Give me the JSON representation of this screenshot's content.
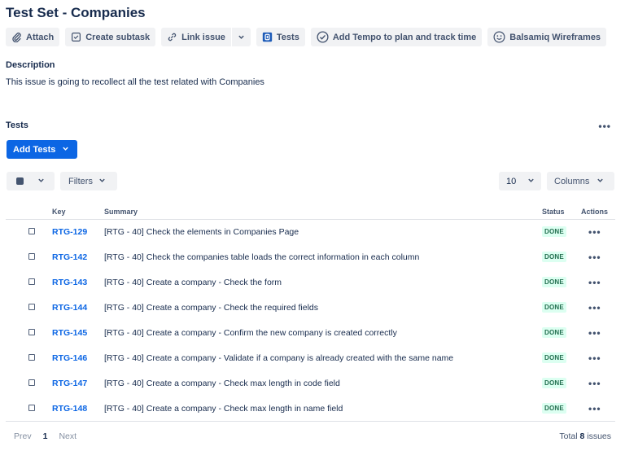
{
  "issue": {
    "title": "Test Set - Companies"
  },
  "toolbar": {
    "attach": "Attach",
    "create_subtask": "Create subtask",
    "link_issue": "Link issue",
    "tests": "Tests",
    "tempo": "Add Tempo to plan and track time",
    "balsamiq": "Balsamiq Wireframes"
  },
  "description": {
    "heading": "Description",
    "text": "This issue is going to recollect all the test related with Companies"
  },
  "tests": {
    "heading": "Tests",
    "more": "•••",
    "add_button": "Add Tests",
    "filters_label": "Filters",
    "page_size": "10",
    "columns_label": "Columns",
    "columns": {
      "key": "Key",
      "summary": "Summary",
      "status": "Status",
      "actions": "Actions"
    },
    "rows": [
      {
        "key": "RTG-129",
        "summary": "[RTG - 40] Check the elements in Companies Page",
        "status": "DONE",
        "actions": "•••"
      },
      {
        "key": "RTG-142",
        "summary": "[RTG - 40] Check the companies table loads the correct information in each column",
        "status": "DONE",
        "actions": "•••"
      },
      {
        "key": "RTG-143",
        "summary": "[RTG - 40] Create a company - Check the form",
        "status": "DONE",
        "actions": "•••"
      },
      {
        "key": "RTG-144",
        "summary": "[RTG - 40] Create a company - Check the required fields",
        "status": "DONE",
        "actions": "•••"
      },
      {
        "key": "RTG-145",
        "summary": "[RTG - 40] Create a company - Confirm the new company is created correctly",
        "status": "DONE",
        "actions": "•••"
      },
      {
        "key": "RTG-146",
        "summary": "[RTG - 40] Create a company - Validate if a company is already created with the same name",
        "status": "DONE",
        "actions": "•••"
      },
      {
        "key": "RTG-147",
        "summary": "[RTG - 40] Create a company - Check max length in code field",
        "status": "DONE",
        "actions": "•••"
      },
      {
        "key": "RTG-148",
        "summary": "[RTG - 40] Create a company - Check max length in name field",
        "status": "DONE",
        "actions": "•••"
      }
    ]
  },
  "pagination": {
    "prev": "Prev",
    "current": "1",
    "next": "Next",
    "total_prefix": "Total",
    "total_count": "8",
    "total_suffix": "issues"
  },
  "colors": {
    "primary": "#0c66e4",
    "done_bg": "#dcfff1",
    "done_text": "#216e4e",
    "button_bg": "#f1f2f4"
  }
}
